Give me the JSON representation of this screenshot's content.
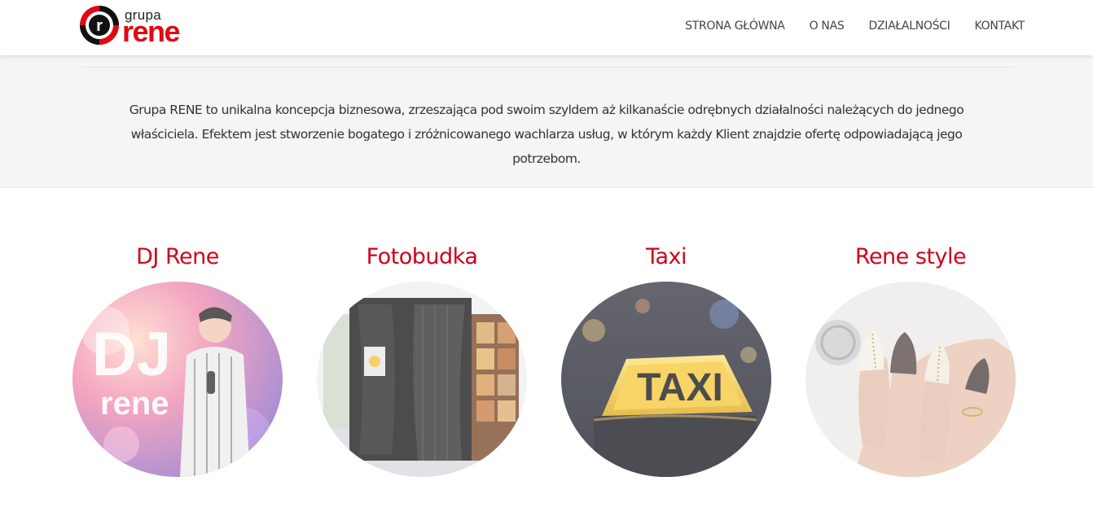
{
  "header": {
    "logo": {
      "top_word": "grupa",
      "main_word": "rene",
      "mark_letter": "r"
    },
    "nav": [
      "STRONA GŁÓWNA",
      "O NAS",
      "DZIAŁALNOŚCI",
      "KONTAKT"
    ]
  },
  "intro": {
    "text": "Grupa RENE to unikalna koncepcja biznesowa, zrzeszająca pod swoim szyldem aż kilkanaście odrębnych działalności należących do jednego właściciela. Efektem jest stworzenie bogatego i zróżnicowanego wachlarza usług, w którym każdy Klient znajdzie ofertę odpowiadającą jego potrzebom."
  },
  "services": [
    {
      "title": "DJ Rene",
      "image": {
        "dj": "DJ",
        "rene": "rene"
      }
    },
    {
      "title": "Fotobudka"
    },
    {
      "title": "Taxi",
      "image": {
        "sign": "TAXI"
      }
    },
    {
      "title": "Rene style"
    }
  ],
  "colors": {
    "accent": "#d0021b",
    "logo_red": "#e30613",
    "intro_bg": "#f5f5f5"
  }
}
